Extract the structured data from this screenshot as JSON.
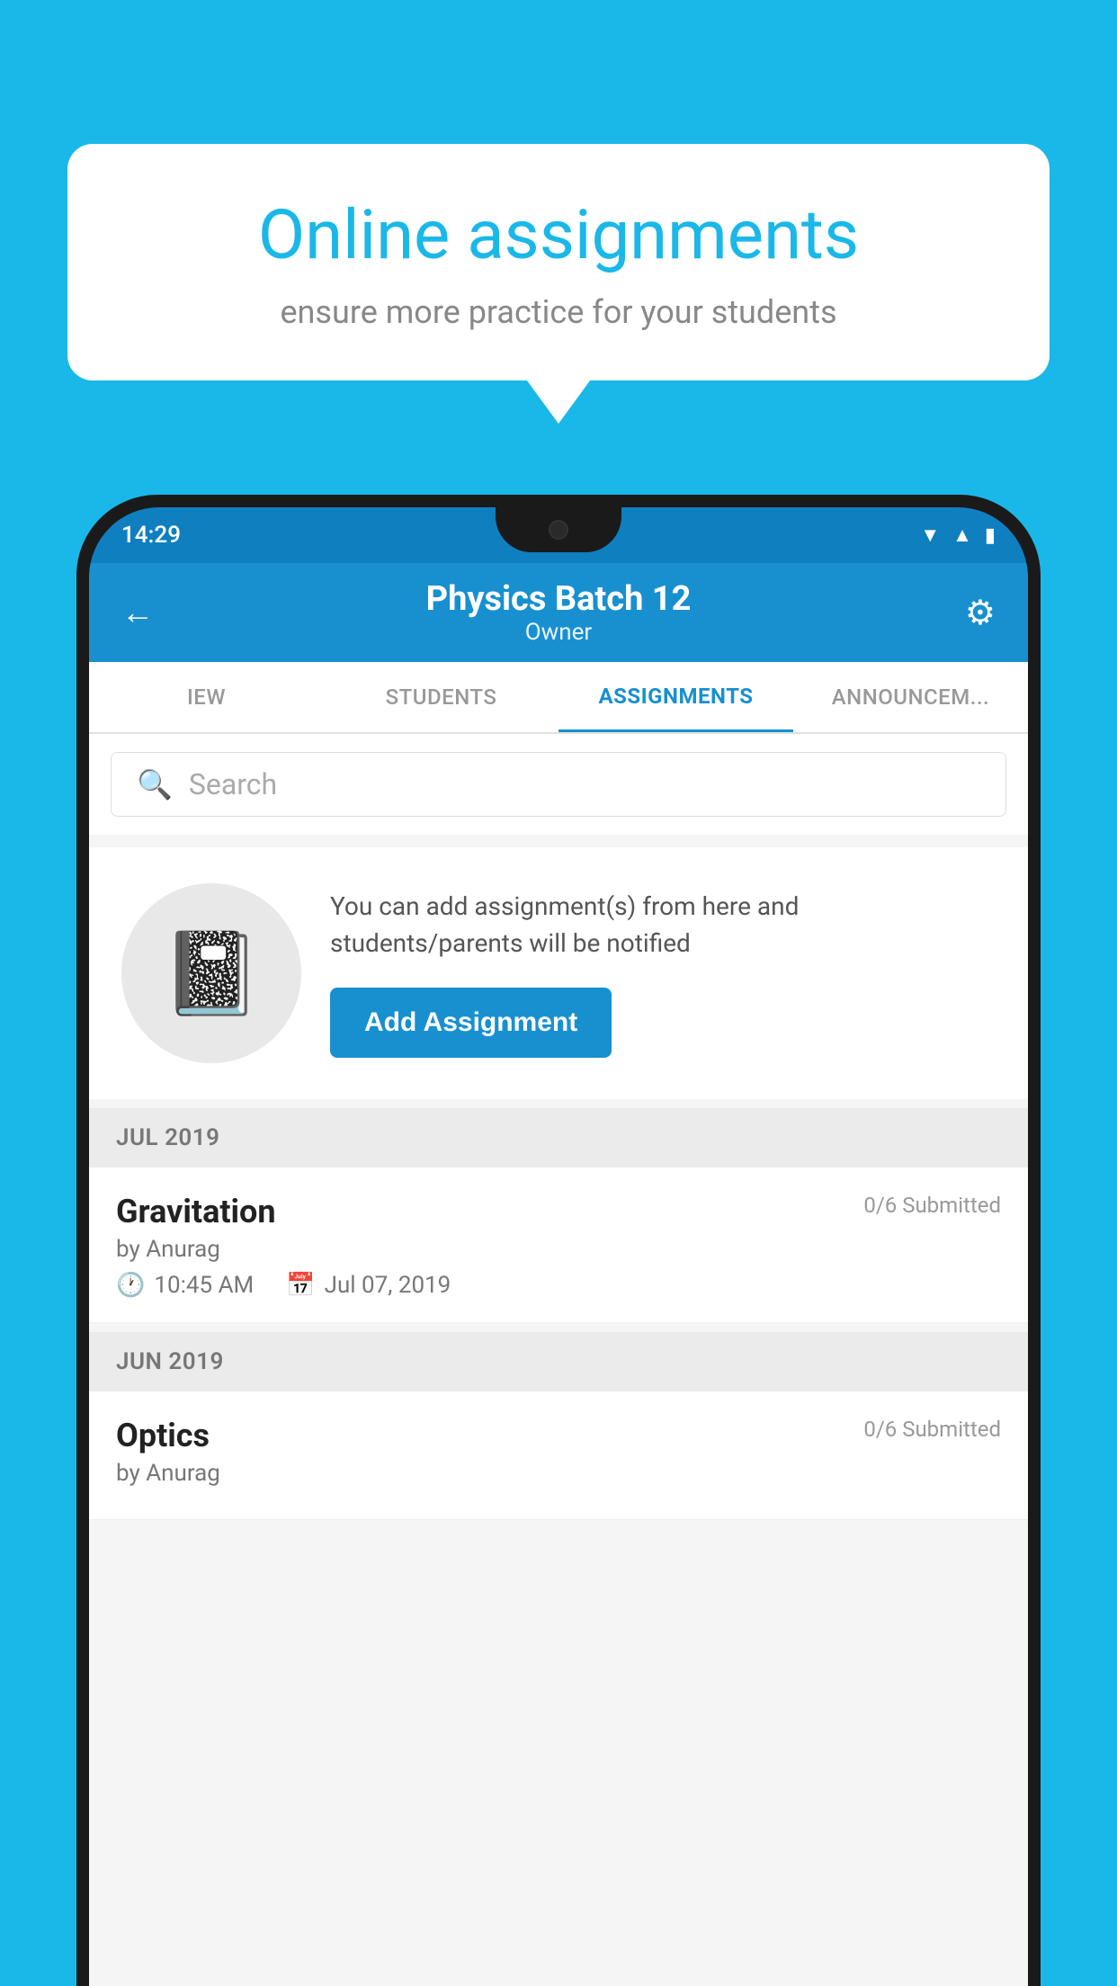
{
  "background": {
    "color": "#1ab8e8"
  },
  "speech_bubble": {
    "title": "Online assignments",
    "subtitle": "ensure more practice for your students"
  },
  "phone": {
    "status_bar": {
      "time": "14:29",
      "wifi": "▾",
      "signal": "◢",
      "battery": "▮"
    },
    "header": {
      "title": "Physics Batch 12",
      "subtitle": "Owner",
      "back_label": "←",
      "settings_label": "⚙"
    },
    "tabs": [
      {
        "label": "IEW",
        "active": false
      },
      {
        "label": "STUDENTS",
        "active": false
      },
      {
        "label": "ASSIGNMENTS",
        "active": true
      },
      {
        "label": "ANNOUNCEM...",
        "active": false
      }
    ],
    "search": {
      "placeholder": "Search"
    },
    "promo": {
      "description": "You can add assignment(s) from here and students/parents will be notified",
      "add_button_label": "Add Assignment",
      "icon": "📓"
    },
    "sections": [
      {
        "label": "JUL 2019",
        "assignments": [
          {
            "name": "Gravitation",
            "submitted": "0/6 Submitted",
            "by": "by Anurag",
            "time": "10:45 AM",
            "date": "Jul 07, 2019"
          }
        ]
      },
      {
        "label": "JUN 2019",
        "assignments": [
          {
            "name": "Optics",
            "submitted": "0/6 Submitted",
            "by": "by Anurag",
            "time": "",
            "date": ""
          }
        ]
      }
    ]
  }
}
